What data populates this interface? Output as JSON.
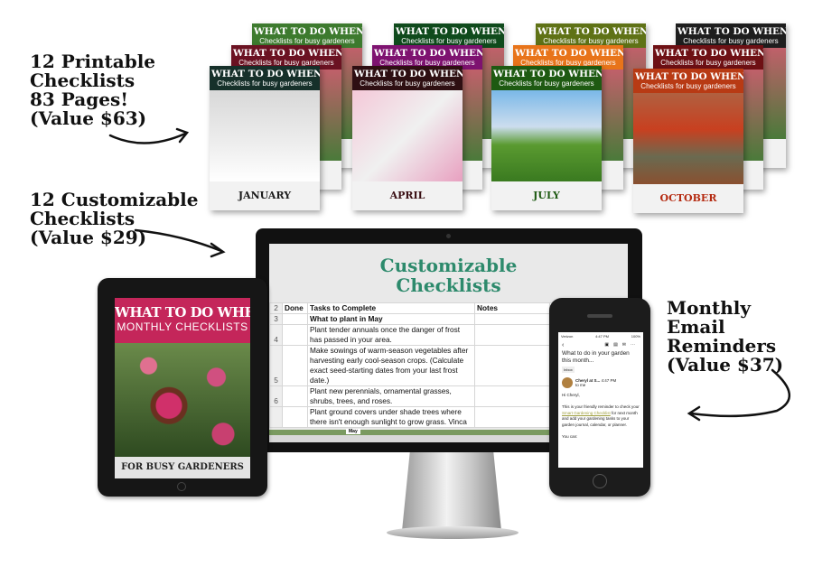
{
  "callouts": {
    "printable": [
      "12 Printable",
      "Checklists",
      "83 Pages!",
      "(Value $63)"
    ],
    "customizable": [
      "12 Customizable",
      "Checklists",
      "(Value $29)"
    ],
    "email": [
      "Monthly",
      "Email",
      "Reminders",
      "(Value $37)"
    ]
  },
  "cards": {
    "title": "WHAT TO DO WHEN",
    "subtitle": "Checklists for busy gardeners",
    "front_months": [
      "JANUARY",
      "APRIL",
      "JULY",
      "OCTOBER"
    ],
    "header_colors": [
      "#3d7a2e",
      "#6b1222",
      "#16302a",
      "#0f4a1c",
      "#7e1270",
      "#2e0f12",
      "#5f7216",
      "#e8741a",
      "#1e5a12",
      "#1e1e1e",
      "#6e1014",
      "#b83a14"
    ],
    "month_colors": [
      "#1a1a1a",
      "#3a0f14",
      "#1e5a12",
      "#b52a10"
    ]
  },
  "spreadsheet": {
    "title": "Customizable Checklists",
    "headers": {
      "row": "2",
      "done": "Done",
      "tasks": "Tasks to Complete",
      "notes": "Notes"
    },
    "section": {
      "row": "3",
      "text": "What to plant in May"
    },
    "rows": [
      {
        "row": "4",
        "text": "Plant tender annuals once the danger of frost has passed in your area."
      },
      {
        "row": "5",
        "text": "Make sowings of warm-season vegetables after harvesting early cool-season crops. (Calculate exact seed-starting dates from your last frost date.)"
      },
      {
        "row": "6",
        "text": "Plant new perennials, ornamental grasses, shrubs, trees, and roses."
      },
      {
        "row": "",
        "text": "Plant ground covers under shade trees where there isn't enough sunlight to grow grass. Vinca"
      }
    ],
    "active_tab": "May"
  },
  "tablet": {
    "title": "WHAT TO DO WHEN",
    "subtitle": "MONTHLY CHECKLISTS",
    "footer": "FOR BUSY GARDENERS"
  },
  "phone": {
    "carrier": "Verizon",
    "time": "4:47 PM",
    "battery": "100%",
    "subject": "What to do in your garden this month...",
    "label": "Inbox",
    "sender": "Cheryl at S...",
    "sent_time": "4:47 PM",
    "to": "to me",
    "greeting": "Hi Cheryl,",
    "body_pre": "This is your friendly reminder to check your ",
    "link": "Smart Gardening Checklist",
    "body_post": " for next month and add your gardening tasks to your garden journal, calendar, or planner.",
    "more": "You can:"
  }
}
